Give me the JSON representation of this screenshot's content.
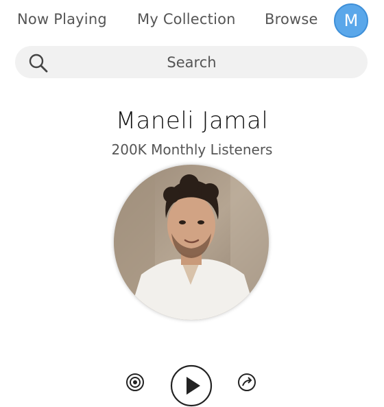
{
  "nav": {
    "now_playing": "Now Playing",
    "my_collection": "My Collection",
    "browse": "Browse",
    "avatar_initial": "M"
  },
  "search": {
    "placeholder": "Search"
  },
  "artist": {
    "name": "Maneli Jamal",
    "listeners": "200K Monthly Listeners"
  },
  "icons": {
    "search": "search-icon",
    "radio": "radio-icon",
    "play": "play-icon",
    "share": "share-icon"
  },
  "colors": {
    "avatar": "#5aa7ea",
    "search_bg": "#f1f1f1"
  }
}
